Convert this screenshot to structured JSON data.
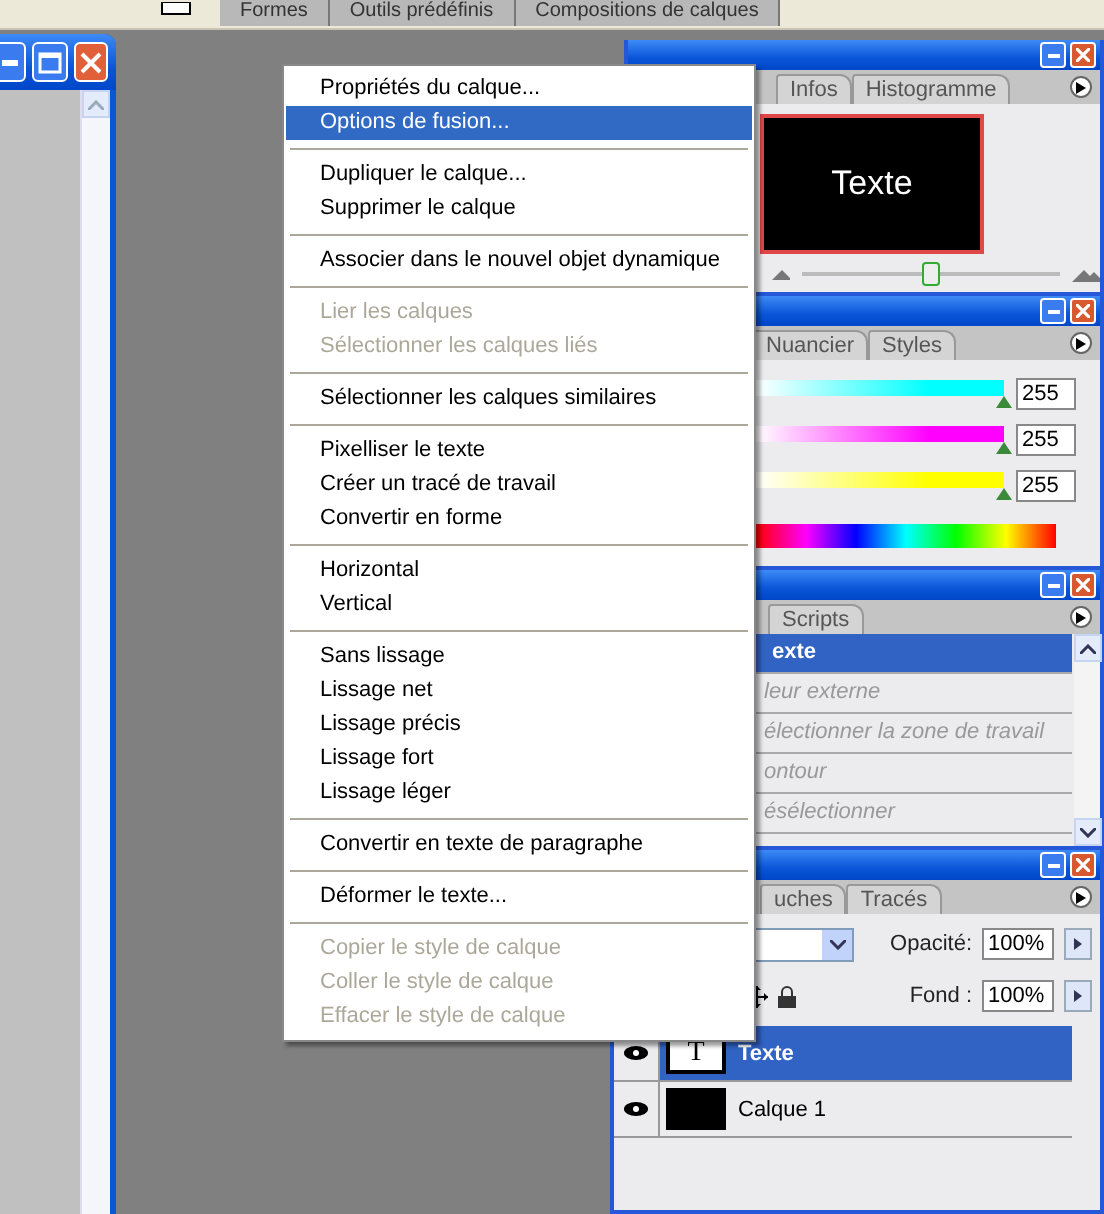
{
  "top_tabs": [
    "Formes",
    "Outils prédéfinis",
    "Compositions de calques"
  ],
  "navigator": {
    "tabs": [
      {
        "label": "Infos",
        "selected": false
      },
      {
        "label": "Histogramme",
        "selected": false
      }
    ],
    "preview_text": "Texte",
    "zoom": {
      "level": 0.5
    }
  },
  "color": {
    "tabs": [
      {
        "label": "Nuancier",
        "selected": false
      },
      {
        "label": "Styles",
        "selected": false
      }
    ],
    "sliders": [
      {
        "value": "255",
        "level": 1,
        "color": "#00ffff"
      },
      {
        "value": "255",
        "level": 1,
        "color": "#ff00ff"
      },
      {
        "value": "255",
        "level": 1,
        "color": "#ffff00"
      }
    ]
  },
  "actions": {
    "tabs": [
      {
        "label": "Scripts",
        "selected": false
      }
    ],
    "items": [
      {
        "label": "exte",
        "selected": true
      },
      {
        "label": "leur externe",
        "selected": false
      },
      {
        "label": "électionner la zone de travail",
        "selected": false
      },
      {
        "label": "ontour",
        "selected": false
      },
      {
        "label": "ésélectionner",
        "selected": false
      }
    ]
  },
  "layers": {
    "tabs": [
      {
        "label": "uches",
        "selected": false
      },
      {
        "label": "Tracés",
        "selected": false
      }
    ],
    "opacity_label": "Opacité:",
    "opacity": "100%",
    "fill_label": "Fond :",
    "fill": "100%",
    "items": [
      {
        "name": "Texte",
        "kind": "text",
        "thumb_label": "T",
        "selected": true,
        "visible": true
      },
      {
        "name": "Calque 1",
        "kind": "fill",
        "selected": false,
        "visible": true
      }
    ]
  },
  "menu": {
    "groups": [
      [
        {
          "label": "Propriétés du calque...",
          "selected": false,
          "disabled": false
        },
        {
          "label": "Options de fusion...",
          "selected": true,
          "disabled": false
        }
      ],
      [
        {
          "label": "Dupliquer le calque...",
          "selected": false,
          "disabled": false
        },
        {
          "label": "Supprimer le calque",
          "selected": false,
          "disabled": false
        }
      ],
      [
        {
          "label": "Associer dans le nouvel objet dynamique",
          "selected": false,
          "disabled": false
        }
      ],
      [
        {
          "label": "Lier les calques",
          "selected": false,
          "disabled": true
        },
        {
          "label": "Sélectionner les calques liés",
          "selected": false,
          "disabled": true
        }
      ],
      [
        {
          "label": "Sélectionner les calques similaires",
          "selected": false,
          "disabled": false
        }
      ],
      [
        {
          "label": "Pixelliser le texte",
          "selected": false,
          "disabled": false
        },
        {
          "label": "Créer un tracé de travail",
          "selected": false,
          "disabled": false
        },
        {
          "label": "Convertir en forme",
          "selected": false,
          "disabled": false
        }
      ],
      [
        {
          "label": "Horizontal",
          "selected": false,
          "disabled": false
        },
        {
          "label": "Vertical",
          "selected": false,
          "disabled": false
        }
      ],
      [
        {
          "label": "Sans lissage",
          "selected": false,
          "disabled": false
        },
        {
          "label": "Lissage net",
          "selected": false,
          "disabled": false
        },
        {
          "label": "Lissage précis",
          "selected": false,
          "disabled": false
        },
        {
          "label": "Lissage fort",
          "selected": false,
          "disabled": false
        },
        {
          "label": "Lissage léger",
          "selected": false,
          "disabled": false
        }
      ],
      [
        {
          "label": "Convertir en texte de paragraphe",
          "selected": false,
          "disabled": false
        }
      ],
      [
        {
          "label": "Déformer le texte...",
          "selected": false,
          "disabled": false
        }
      ],
      [
        {
          "label": "Copier le style de calque",
          "selected": false,
          "disabled": true
        },
        {
          "label": "Coller le style de calque",
          "selected": false,
          "disabled": true
        },
        {
          "label": "Effacer le style de calque",
          "selected": false,
          "disabled": true
        }
      ]
    ]
  }
}
